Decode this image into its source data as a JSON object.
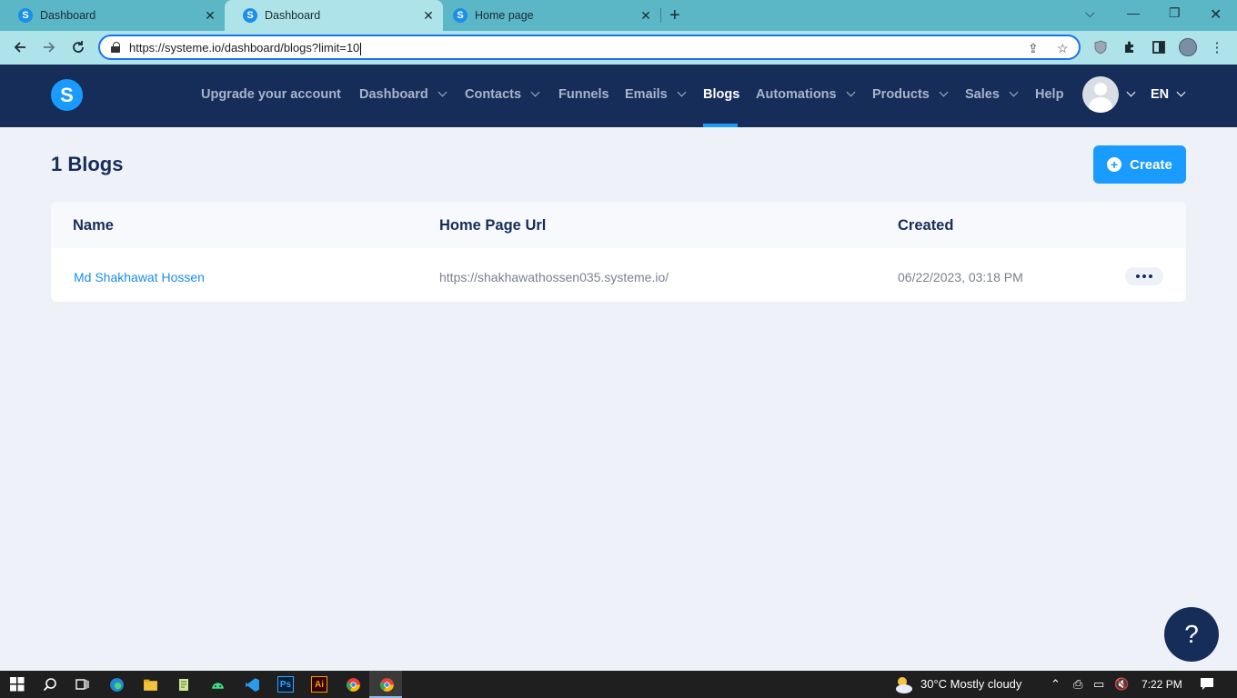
{
  "browser": {
    "tabs": [
      {
        "title": "Dashboard",
        "active": false
      },
      {
        "title": "Dashboard",
        "active": true
      },
      {
        "title": "Home page",
        "active": false
      }
    ],
    "url": "https://systeme.io/dashboard/blogs?limit=10"
  },
  "nav": {
    "logo": "S",
    "items": [
      {
        "label": "Upgrade your account"
      },
      {
        "label": "Dashboard"
      },
      {
        "label": "Contacts"
      },
      {
        "label": "Funnels"
      },
      {
        "label": "Emails"
      },
      {
        "label": "Blogs"
      },
      {
        "label": "Automations"
      },
      {
        "label": "Products"
      },
      {
        "label": "Sales"
      },
      {
        "label": "Help"
      }
    ],
    "language": "EN"
  },
  "page": {
    "title": "1 Blogs",
    "create_label": "Create",
    "columns": [
      "Name",
      "Home Page Url",
      "Created"
    ],
    "rows": [
      {
        "name": "Md Shakhawat Hossen",
        "url": "https://shakhawathossen035.systeme.io/",
        "created": "06/22/2023, 03:18 PM"
      }
    ],
    "help_label": "?"
  },
  "taskbar": {
    "weather": "30°C  Mostly cloudy",
    "time": "7:22 PM",
    "apps": [
      "Ps",
      "Ai"
    ]
  },
  "colors": {
    "nav_bg": "#162d5a",
    "accent": "#1a9bff",
    "page_bg": "#eef2f8",
    "tab_bar": "#5bb7c6"
  },
  "icons": [
    "back-arrow-icon",
    "forward-arrow-icon",
    "reload-icon",
    "lock-icon",
    "share-icon",
    "star-icon",
    "shield-icon",
    "puzzle-icon",
    "sidebar-icon",
    "menu-dots-icon",
    "plus-circle-icon",
    "more-dots-icon",
    "windows-start-icon",
    "search-icon",
    "task-view-icon",
    "edge-icon",
    "explorer-icon",
    "notepad-icon",
    "android-icon",
    "vscode-icon",
    "chrome-icon",
    "cloud-moon-icon",
    "notification-icon"
  ]
}
